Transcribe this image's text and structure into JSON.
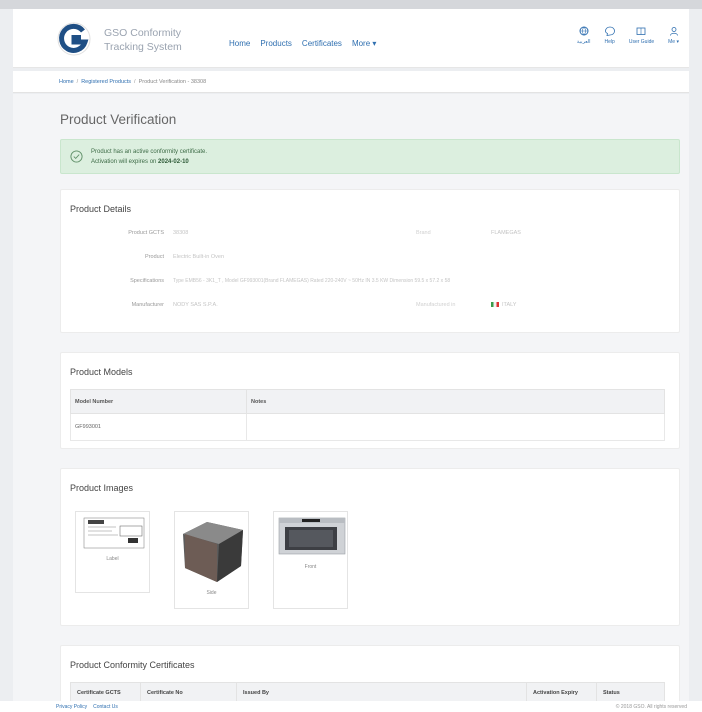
{
  "brand": {
    "line1": "GSO Conformity",
    "line2": "Tracking System"
  },
  "nav": {
    "links": [
      "Home",
      "Products",
      "Certificates",
      "More ▾"
    ],
    "icons": [
      {
        "label": "العربية",
        "icon": "language-icon"
      },
      {
        "label": "Help",
        "icon": "help-icon"
      },
      {
        "label": "User Guide",
        "icon": "book-icon"
      },
      {
        "label": "Me ▾",
        "icon": "user-icon"
      }
    ]
  },
  "breadcrumb": {
    "home": "Home",
    "products": "Registered Products",
    "current": "Product Verification - 38308"
  },
  "page_title": "Product Verification",
  "alert": {
    "line1": "Product has an active conformity certificate.",
    "line2_prefix": "Activation will expires on",
    "expiry": "2024-02-10"
  },
  "details": {
    "title": "Product Details",
    "gcts_label": "Product GCTS",
    "gcts_value": "38308",
    "brand_label": "Brand",
    "brand_value": "FLAMEGAS",
    "product_label": "Product",
    "product_value": "Electric Built-in Oven",
    "spec_label": "Specifications",
    "spec_value": "Type EMB56 - 3K1_T , Model GF993001(Brand FLAMEGAS) Rated 220-240V ~ 50Hz IN 3.5 KW Dimension 59.5 x 57.2 x 58",
    "manufacturer_label": "Manufacturer",
    "manufacturer_value": "NODY SAS S.P.A.",
    "country_label": "Manufactured in",
    "country_value": "ITALY"
  },
  "models": {
    "title": "Product Models",
    "columns": [
      "Model Number",
      "Notes"
    ],
    "rows": [
      [
        "GF993001",
        ""
      ]
    ]
  },
  "images": {
    "title": "Product Images",
    "items": [
      "Label",
      "Side",
      "Front"
    ]
  },
  "certificates": {
    "title": "Product Conformity Certificates",
    "columns": [
      "Certificate GCTS",
      "Certificate No",
      "Issued By",
      "Activation Expiry",
      "Status"
    ]
  },
  "footer": {
    "privacy": "Privacy Policy",
    "contact": "Contact Us",
    "copyright": "© 2018 GSO. All rights reserved"
  },
  "colors": {
    "accent": "#2f6fb0",
    "alert_bg": "#dcefdf",
    "logo": "#1f4f85"
  }
}
